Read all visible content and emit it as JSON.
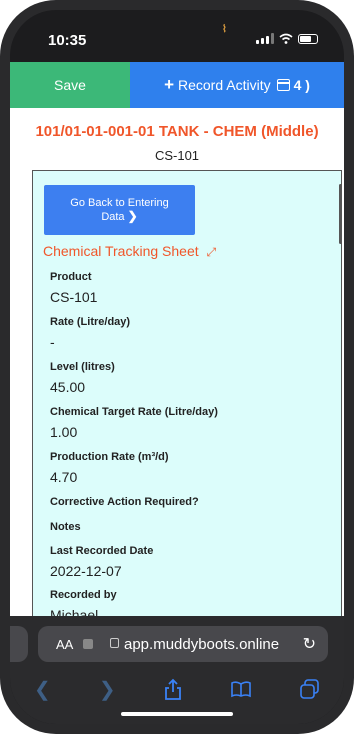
{
  "status": {
    "time": "10:35"
  },
  "header": {
    "save_label": "Save",
    "record_label": "Record Activity",
    "record_count": "4 )",
    "plus_icon": "+",
    "calendar_icon": "calendar-icon"
  },
  "page": {
    "title": "101/01-01-001-01 TANK - CHEM (Middle)",
    "subtitle": "CS-101"
  },
  "panel": {
    "back_button": {
      "line1": "Go Back to Entering",
      "line2": "Data",
      "chevron": "❯"
    },
    "sheet_title": "Chemical Tracking Sheet",
    "expand_icon": "⤢",
    "fields": [
      {
        "label": "Product",
        "value": "CS-101"
      },
      {
        "label": "Rate (Litre/day)",
        "value": "-"
      },
      {
        "label": "Level (litres)",
        "value": "45.00"
      },
      {
        "label": "Chemical Target Rate (Litre/day)",
        "value": "1.00"
      },
      {
        "label": "Production Rate (m³/d)",
        "value": "4.70"
      },
      {
        "label": "Corrective Action Required?",
        "value": ""
      },
      {
        "label": "Notes",
        "value": ""
      },
      {
        "label": "Last Recorded Date",
        "value": "2022-12-07"
      },
      {
        "label": "Recorded by",
        "value": "Michael"
      }
    ],
    "scroll_top_icon": "🡑"
  },
  "browser": {
    "aa": "AA",
    "url": "app.muddyboots.online",
    "reload_icon": "↻",
    "toolbar": [
      "❮",
      "❯",
      "⇪",
      "📖",
      "❐"
    ]
  }
}
